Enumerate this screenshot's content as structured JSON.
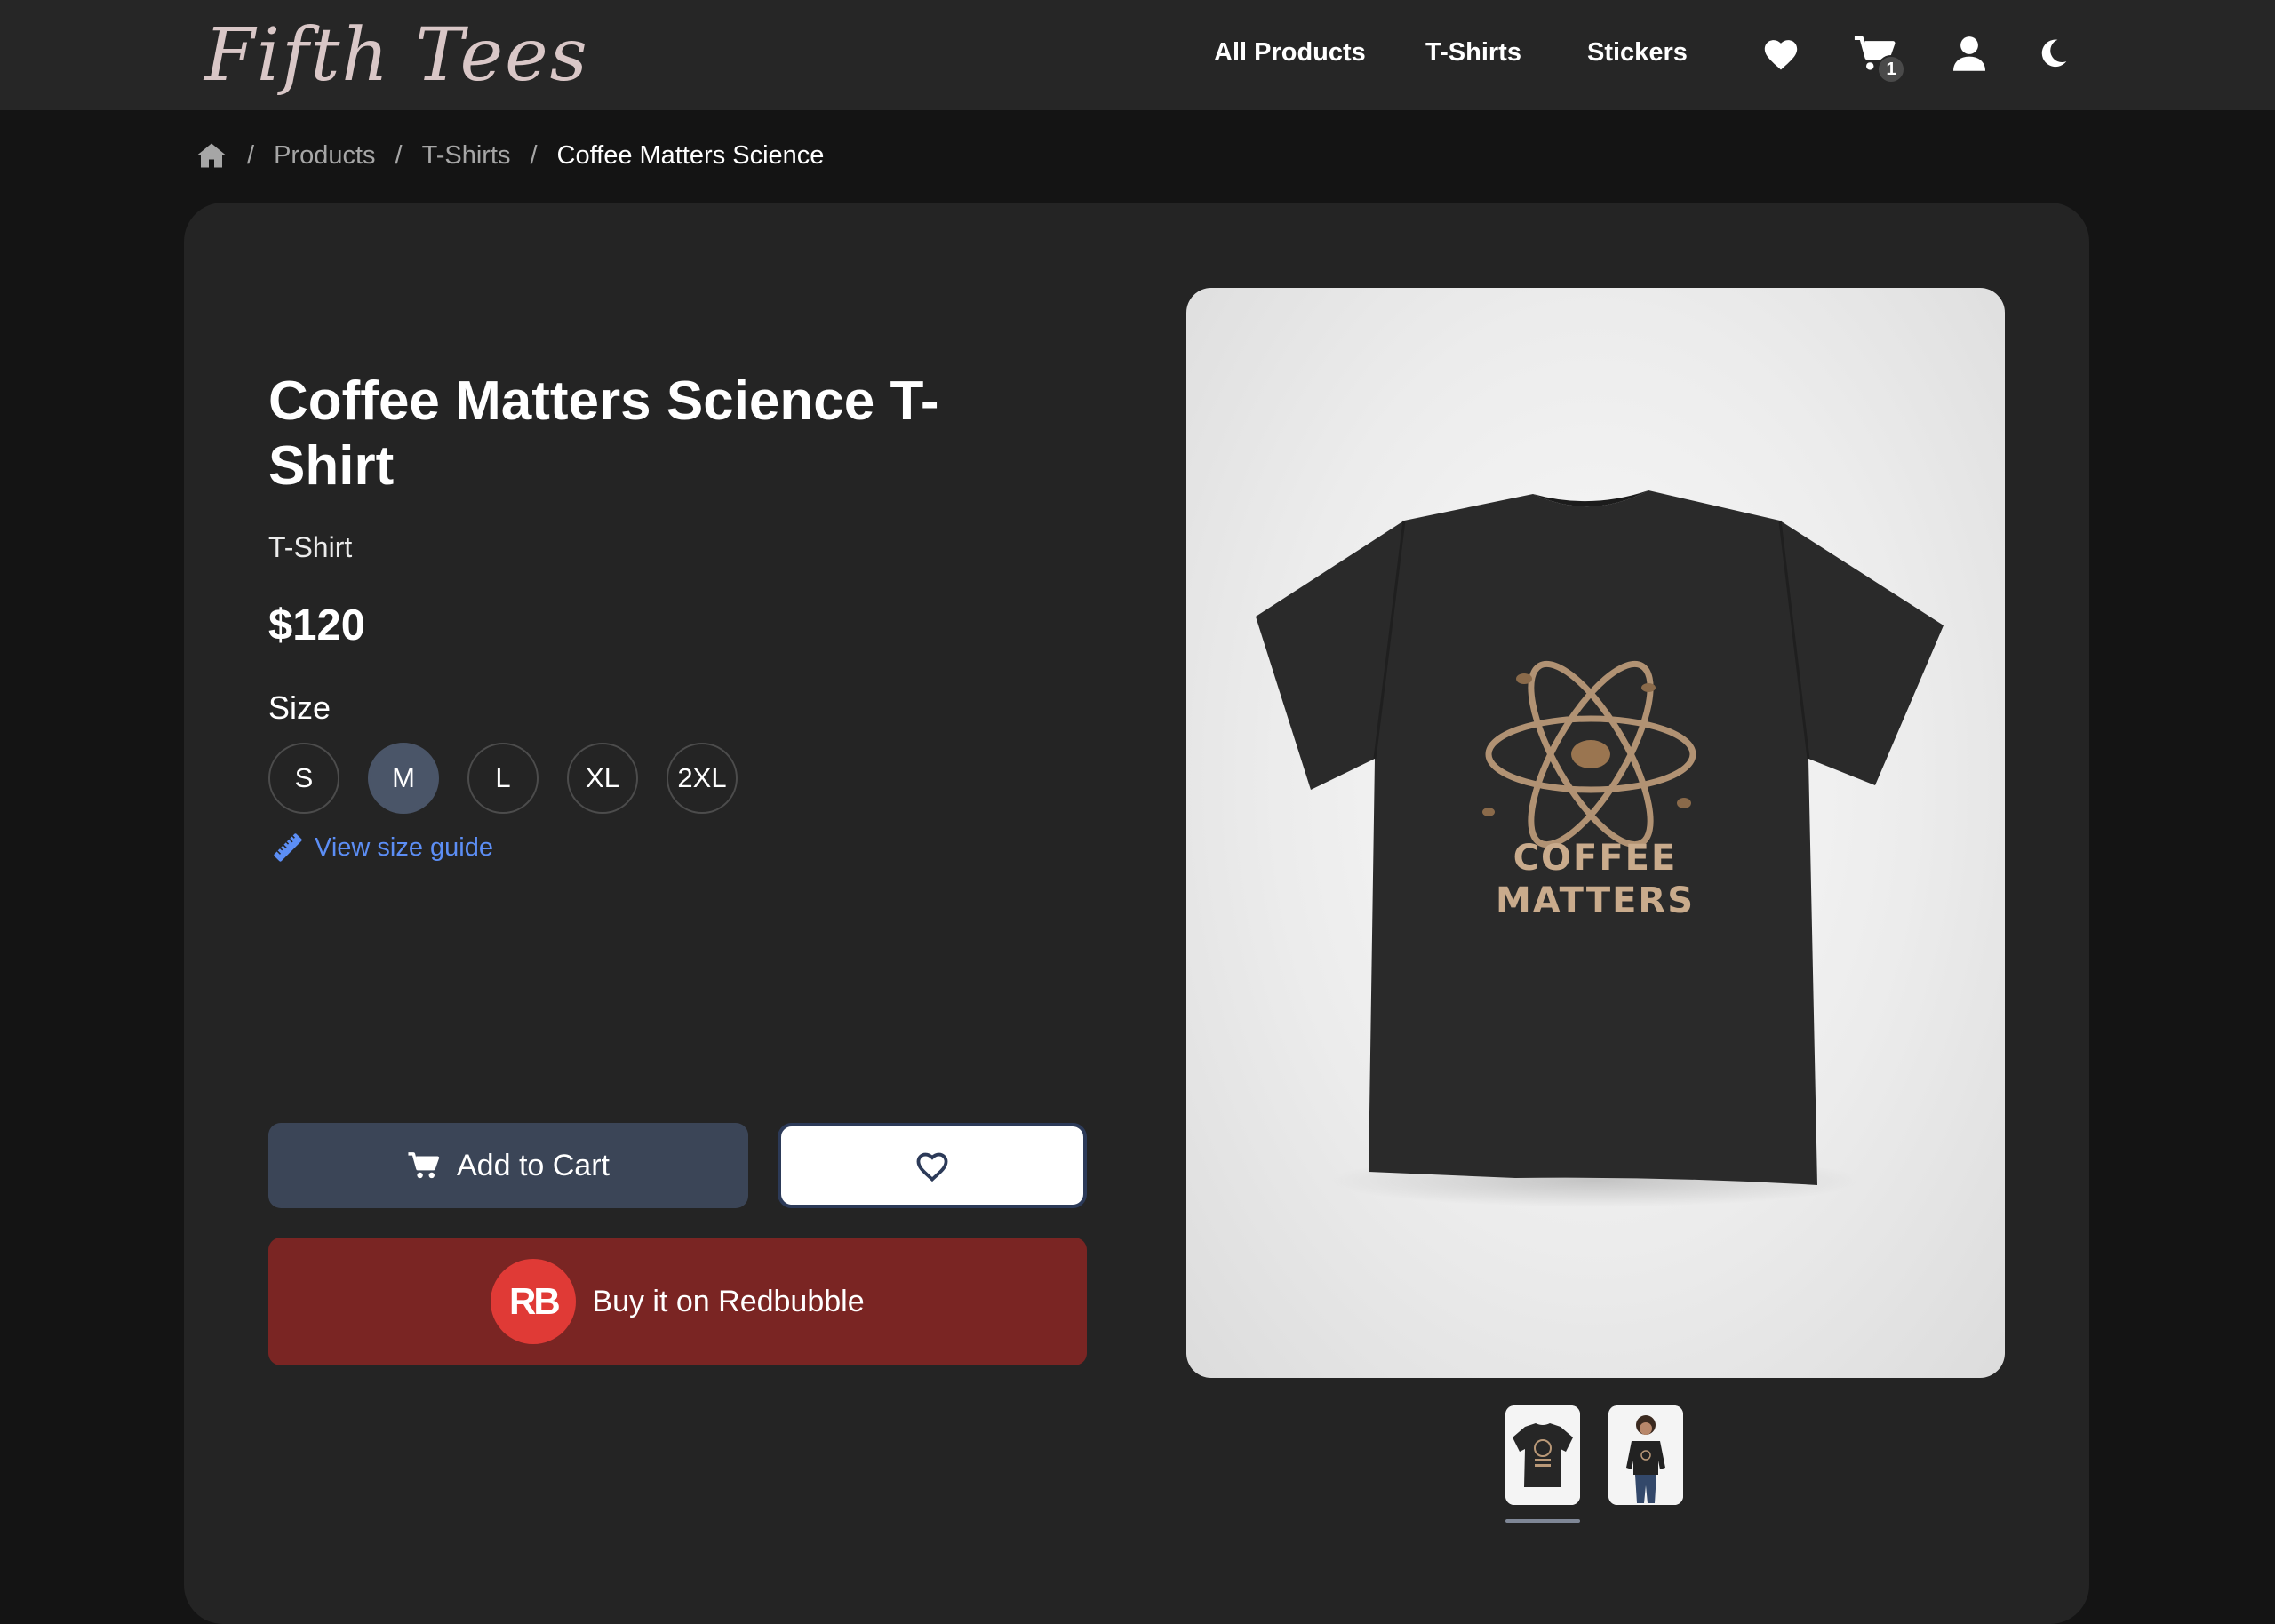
{
  "header": {
    "logo": "Fifth Tees",
    "nav": [
      "All Products",
      "T-Shirts",
      "Stickers"
    ],
    "icons": [
      "heart-icon",
      "cart-icon",
      "user-icon",
      "moon-icon"
    ],
    "cart_count": "1"
  },
  "breadcrumb": {
    "home_icon": "home-icon",
    "items": [
      "Products",
      "T-Shirts"
    ],
    "current": "Coffee Matters Science"
  },
  "product": {
    "title": "Coffee Matters Science T-Shirt",
    "category": "T-Shirt",
    "price": "$120",
    "size_label": "Size",
    "sizes": [
      "S",
      "M",
      "L",
      "XL",
      "2XL"
    ],
    "selected_size": "M",
    "size_guide": "View size guide",
    "add_to_cart": "Add to Cart",
    "buy_redbubble": "Buy it on Redbubble",
    "redbubble_logo": "RB",
    "shirt_print": [
      "COFFEE",
      "MATTERS"
    ]
  },
  "colors": {
    "accent": "#4a5568",
    "link": "#5c8ef5",
    "redbubble": "#7a2523"
  }
}
